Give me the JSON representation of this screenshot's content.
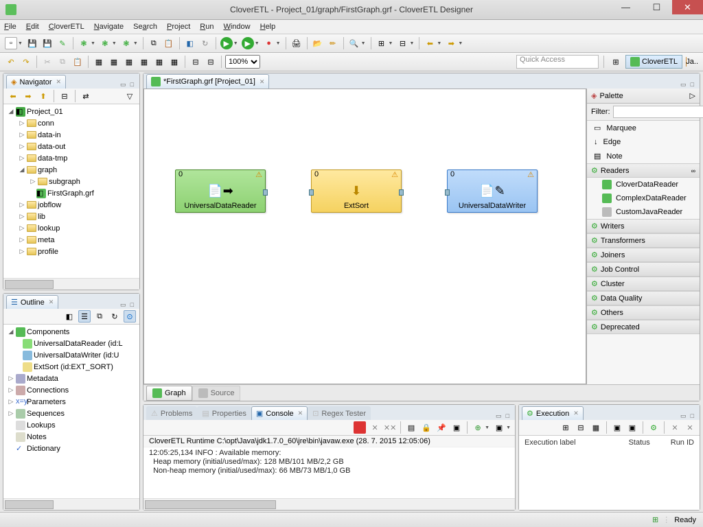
{
  "window": {
    "title": "CloverETL - Project_01/graph/FirstGraph.grf - CloverETL Designer"
  },
  "menu": [
    "File",
    "Edit",
    "CloverETL",
    "Navigate",
    "Search",
    "Project",
    "Run",
    "Window",
    "Help"
  ],
  "toolbar2": {
    "zoom": "100%",
    "quick_access": "Quick Access",
    "persp1": "CloverETL",
    "persp2": "Java"
  },
  "navigator": {
    "title": "Navigator",
    "tree": {
      "project": "Project_01",
      "folders": [
        "conn",
        "data-in",
        "data-out",
        "data-tmp"
      ],
      "graph_folder": "graph",
      "subgraph": "subgraph",
      "graph_file": "FirstGraph.grf",
      "rest": [
        "jobflow",
        "lib",
        "lookup",
        "meta",
        "profile"
      ]
    }
  },
  "outline": {
    "title": "Outline",
    "components_label": "Components",
    "items": [
      "UniversalDataReader (id:UNIVERSAL_DATA_READER)",
      "UniversalDataWriter (id:UNIVERSAL_DATA_WRITER)",
      "ExtSort (id:EXT_SORT)"
    ],
    "items_short": {
      "a": "UniversalDataReader (id:L",
      "b": "UniversalDataWriter (id:U",
      "c": "ExtSort (id:EXT_SORT)"
    },
    "sections": [
      "Metadata",
      "Connections",
      "Parameters",
      "Sequences",
      "Lookups",
      "Notes",
      "Dictionary"
    ]
  },
  "editor": {
    "tab": "*FirstGraph.grf [Project_01]",
    "comp1": "UniversalDataReader",
    "comp2": "ExtSort",
    "comp3": "UniversalDataWriter",
    "btab1": "Graph",
    "btab2": "Source"
  },
  "palette": {
    "title": "Palette",
    "filter": "Filter:",
    "tools": [
      "Marquee",
      "Edge",
      "Note"
    ],
    "readers_hdr": "Readers",
    "readers": [
      "CloverDataReader",
      "ComplexDataReader",
      "CustomJavaReader"
    ],
    "cats": [
      "Writers",
      "Transformers",
      "Joiners",
      "Job Control",
      "Cluster",
      "Data Quality",
      "Others",
      "Deprecated"
    ]
  },
  "bottom_tabs": {
    "problems": "Problems",
    "properties": "Properties",
    "console": "Console",
    "regex": "Regex Tester"
  },
  "console": {
    "header": "CloverETL Runtime  C:\\opt\\Java\\jdk1.7.0_60\\jre\\bin\\javaw.exe (28. 7. 2015 12:05:06)",
    "l1": "12:05:25,134 INFO : Available memory:",
    "l2": "  Heap memory (initial/used/max): 128 MB/101 MB/2,2 GB",
    "l3": "  Non-heap memory (initial/used/max): 66 MB/73 MB/1,0 GB"
  },
  "execution": {
    "title": "Execution",
    "c1": "Execution label",
    "c2": "Status",
    "c3": "Run ID"
  },
  "status": {
    "ready": "Ready"
  }
}
